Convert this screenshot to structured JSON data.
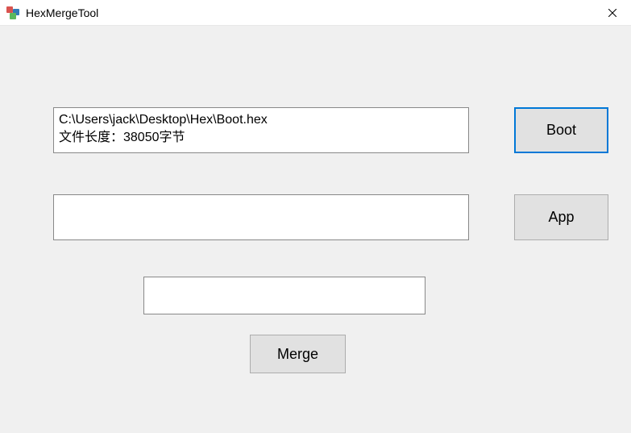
{
  "window": {
    "title": "HexMergeTool"
  },
  "boot": {
    "path": "C:\\Users\\jack\\Desktop\\Hex\\Boot.hex",
    "length_line": "文件长度：38050字节",
    "button_label": "Boot"
  },
  "app": {
    "path": "",
    "length_line": "",
    "button_label": "App"
  },
  "output": {
    "path": ""
  },
  "merge": {
    "button_label": "Merge"
  }
}
